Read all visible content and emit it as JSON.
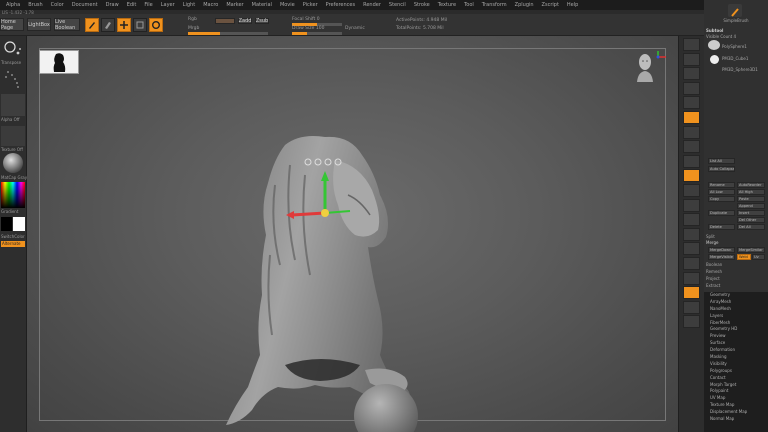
{
  "menubar": {
    "items": [
      "Alpha",
      "Brush",
      "Color",
      "Document",
      "Draw",
      "Edit",
      "File",
      "Layer",
      "Light",
      "Macro",
      "Marker",
      "Material",
      "Movie",
      "Picker",
      "Preferences",
      "Render",
      "Stencil",
      "Stroke",
      "Texture",
      "Tool",
      "Transform",
      "Zplugin",
      "Zscript",
      "Help"
    ]
  },
  "status": {
    "text": "LIS -1.432 -1.78"
  },
  "shelf": {
    "home_page": "Home Page",
    "lightbox": "LightBox",
    "live_boolean": "Live Boolean",
    "edit_label": "Edit",
    "draw_label": "Draw",
    "move_label": "Move",
    "scale_label": "Scale",
    "rotate_label": "Rotate",
    "focal_shift": "Focal Shift 0",
    "draw_size": "Draw Size 100",
    "dynamic": "Dynamic",
    "active_points": "ActivePoints: 4.948 Mil",
    "total_points": "TotalPoints: 5.708 Mil",
    "rgb_label": "Rgb",
    "zadd_label": "Zadd",
    "zsub_label": "Zsub",
    "mrgb_label": "Mrgb"
  },
  "lefttray": {
    "transpose": "Transpose",
    "alpha_off": "Alpha Off",
    "texture_off": "Texture Off",
    "matcap": "MatCap Gray",
    "gradient": "Gradient",
    "switch_color": "SwitchColor",
    "alternate": "Alternate"
  },
  "righttray": {
    "count": 20
  },
  "rightpanel": {
    "brush_label": "SimpleBrush",
    "subtool_title": "Subtool",
    "visible_count": "Visible Count 4",
    "items": [
      "PolySphere1",
      "PM3D_Cube1",
      "PM3D_Sphere3D1"
    ],
    "list_all": "List All",
    "auto_collapse": "Auto Collapse",
    "rename": "Rename",
    "auto_reorder": "AutoReorder",
    "all_low": "All Low",
    "all_high": "All High",
    "copy": "Copy",
    "paste": "Paste",
    "append": "Append",
    "duplicate": "Duplicate",
    "insert": "Insert",
    "del_other": "Del Other",
    "delete": "Delete",
    "del_all": "Del All",
    "split": "Split",
    "merge": "Merge",
    "merge_down": "MergeDown",
    "merge_similar": "MergeSimilar",
    "merge_visible": "MergeVisible",
    "weld": "Weld",
    "uv": "Uv",
    "boolean": "Boolean",
    "remesh": "Remesh",
    "project": "Project",
    "extract": "Extract"
  },
  "submenu": [
    "Geometry",
    "ArrayMesh",
    "NanoMesh",
    "Layers",
    "FiberMesh",
    "Geometry HD",
    "Preview",
    "Surface",
    "Deformation",
    "Masking",
    "Visibility",
    "Polygroups",
    "Contact",
    "Morph Target",
    "Polypaint",
    "UV Map",
    "Texture Map",
    "Displacement Map",
    "Normal Map"
  ],
  "colors": {
    "accent": "#f0921e",
    "model": "#8a8a8a",
    "bg": "#2b2b2b"
  }
}
